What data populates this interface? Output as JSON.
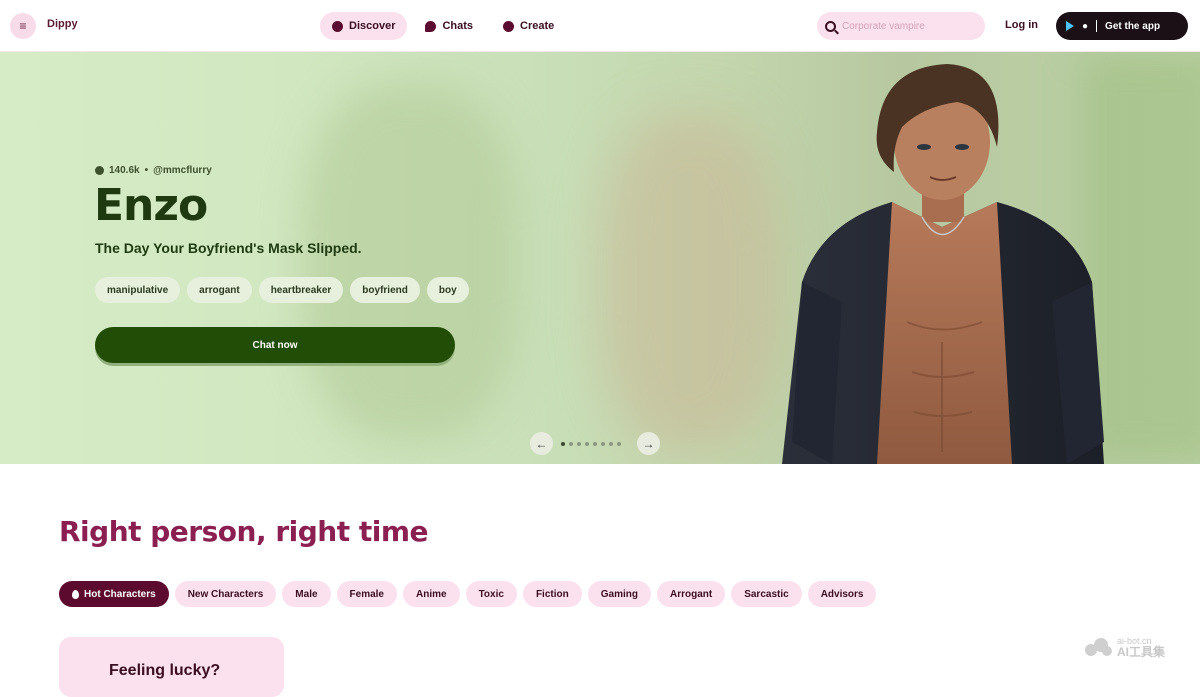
{
  "header": {
    "brand": "Dippy",
    "nav": [
      {
        "label": "Discover",
        "active": true,
        "icon": "compass-icon"
      },
      {
        "label": "Chats",
        "active": false,
        "icon": "chat-bubble-icon"
      },
      {
        "label": "Create",
        "active": false,
        "icon": "create-icon"
      }
    ],
    "search_placeholder": "Corporate vampire",
    "login_label": "Log in",
    "get_app_label": "Get the app"
  },
  "hero": {
    "chat_count": "140.6k",
    "separator": "•",
    "author": "@mmcflurry",
    "name": "Enzo",
    "tagline": "The Day Your Boyfriend's Mask Slipped.",
    "tags": [
      "manipulative",
      "arrogant",
      "heartbreaker",
      "boyfriend",
      "boy"
    ],
    "cta_label": "Chat now",
    "carousel_prev": "←",
    "carousel_next": "→",
    "carousel_dot_count": 8,
    "carousel_active_index": 0
  },
  "section": {
    "title": "Right person, right time",
    "categories": [
      {
        "label": "Hot Characters",
        "active": true
      },
      {
        "label": "New Characters",
        "active": false
      },
      {
        "label": "Male",
        "active": false
      },
      {
        "label": "Female",
        "active": false
      },
      {
        "label": "Anime",
        "active": false
      },
      {
        "label": "Toxic",
        "active": false
      },
      {
        "label": "Fiction",
        "active": false
      },
      {
        "label": "Gaming",
        "active": false
      },
      {
        "label": "Arrogant",
        "active": false
      },
      {
        "label": "Sarcastic",
        "active": false
      },
      {
        "label": "Advisors",
        "active": false
      }
    ],
    "lucky_title": "Feeling lucky?"
  },
  "watermark": {
    "line1": "ai-bot.cn",
    "line2": "AI工具集"
  },
  "colors": {
    "brand_pink": "#fbe0ee",
    "brand_maroon": "#5c0a2e",
    "hero_green": "#214d07",
    "section_title": "#8b1f52"
  }
}
